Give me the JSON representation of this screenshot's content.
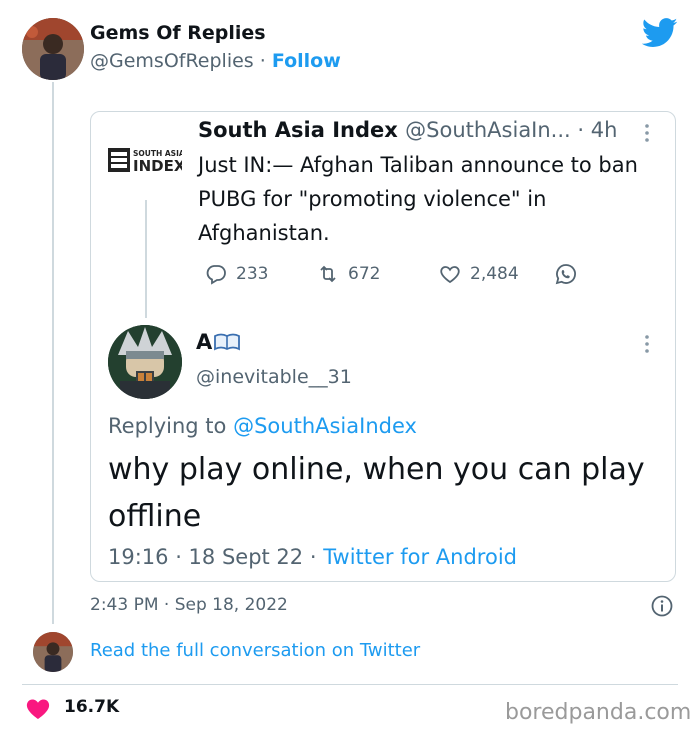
{
  "tweet": {
    "author_name": "Gems Of Replies",
    "author_handle": "@GemsOfReplies",
    "separator": "·",
    "follow_label": "Follow",
    "timestamp": "2:43 PM · Sep 18, 2022",
    "read_more_label": "Read the full conversation on Twitter",
    "likes": "16.7K"
  },
  "quoted": {
    "logo_line1": "SOUTH ASIA",
    "logo_line2": "INDEX",
    "name": "South Asia Index",
    "handle_time": "@SouthAsiaIn... · 4h",
    "text": "Just IN:— Afghan Taliban announce to ban PUBG for \"promoting violence\"  in Afghanistan.",
    "replies": "233",
    "retweets": "672",
    "likes": "2,484"
  },
  "reply": {
    "name": "A",
    "handle": "@inevitable__31",
    "replying_prefix": "Replying to",
    "replying_to": "@SouthAsiaIndex",
    "text": "why play online, when you can play offline",
    "time_date": "19:16 · 18 Sept 22 · ",
    "source": "Twitter for Android"
  },
  "watermark": "boredpanda.com",
  "colors": {
    "accent": "#1d9bf0",
    "secondary_text": "#536471",
    "heart": "#f91880"
  },
  "icons": [
    "twitter-bird-icon",
    "more-icon",
    "reply-icon",
    "retweet-icon",
    "like-icon",
    "whatsapp-icon",
    "book-emoji-icon",
    "info-icon",
    "heart-icon"
  ]
}
